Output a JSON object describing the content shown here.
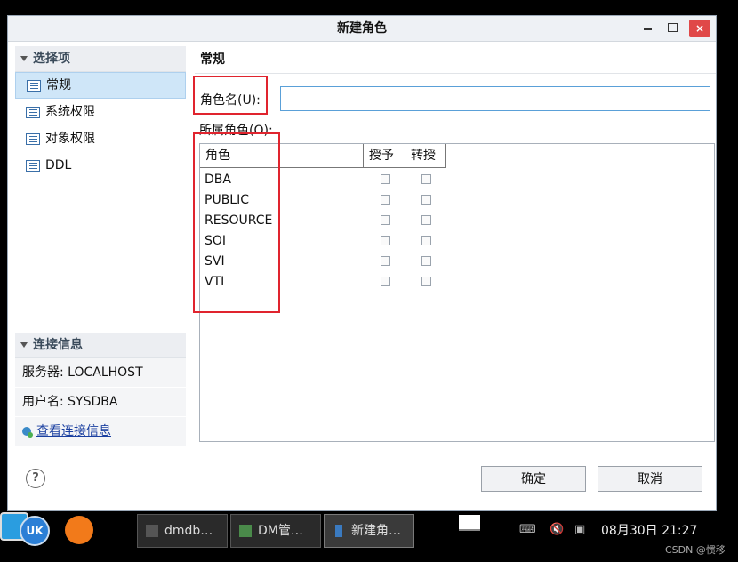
{
  "window": {
    "title": "新建角色",
    "min_label": "",
    "close_label": "×"
  },
  "left": {
    "section_title": "选择项",
    "items": [
      {
        "label": "常规",
        "selected": true
      },
      {
        "label": "系统权限",
        "selected": false
      },
      {
        "label": "对象权限",
        "selected": false
      },
      {
        "label": "DDL",
        "selected": false
      }
    ],
    "conn_title": "连接信息",
    "server": "服务器: LOCALHOST",
    "user": "用户名: SYSDBA",
    "view_conn": "查看连接信息"
  },
  "main": {
    "section_title": "常规",
    "role_name_label": "角色名(U):",
    "role_name_value": "",
    "owned_roles_label": "所属角色(O):",
    "columns": [
      "角色",
      "授予",
      "转授"
    ],
    "rows": [
      {
        "name": "DBA",
        "grant": false,
        "regrant": false
      },
      {
        "name": "PUBLIC",
        "grant": false,
        "regrant": false
      },
      {
        "name": "RESOURCE",
        "grant": false,
        "regrant": false
      },
      {
        "name": "SOI",
        "grant": false,
        "regrant": false
      },
      {
        "name": "SVI",
        "grant": false,
        "regrant": false
      },
      {
        "name": "VTI",
        "grant": false,
        "regrant": false
      }
    ]
  },
  "buttons": {
    "help": "?",
    "ok": "确定",
    "cancel": "取消"
  },
  "taskbar": {
    "start_label": "UK",
    "tasks": [
      {
        "label": "dmdb…",
        "icon": "terminal-icon"
      },
      {
        "label": "DM管…",
        "icon": "dm-manager-icon"
      },
      {
        "label": "新建角…",
        "icon": "java-icon"
      }
    ],
    "clock": "08月30日 21:27",
    "watermark": "CSDN @惯移"
  },
  "colors": {
    "highlight_red": "#e0242e",
    "selected_bg": "#cfe6f8",
    "input_border": "#5aa0d8"
  }
}
